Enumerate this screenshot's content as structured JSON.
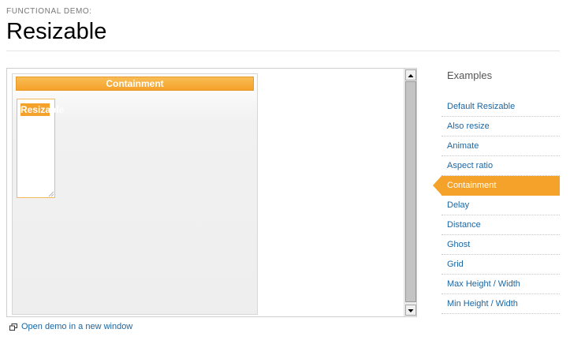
{
  "header": {
    "eyebrow": "FUNCTIONAL DEMO:",
    "title": "Resizable"
  },
  "demo": {
    "container_label": "Containment",
    "resizable_label": "Resizable"
  },
  "open_demo_link": "Open demo in a new window",
  "sidebar": {
    "title": "Examples",
    "items": [
      {
        "label": "Default Resizable"
      },
      {
        "label": "Also resize"
      },
      {
        "label": "Animate"
      },
      {
        "label": "Aspect ratio"
      },
      {
        "label": "Containment",
        "active": true
      },
      {
        "label": "Delay"
      },
      {
        "label": "Distance"
      },
      {
        "label": "Ghost"
      },
      {
        "label": "Grid"
      },
      {
        "label": "Max Height / Width"
      },
      {
        "label": "Min Height / Width"
      }
    ]
  },
  "colors": {
    "accent": "#f5a22a",
    "link": "#1a66a3"
  }
}
